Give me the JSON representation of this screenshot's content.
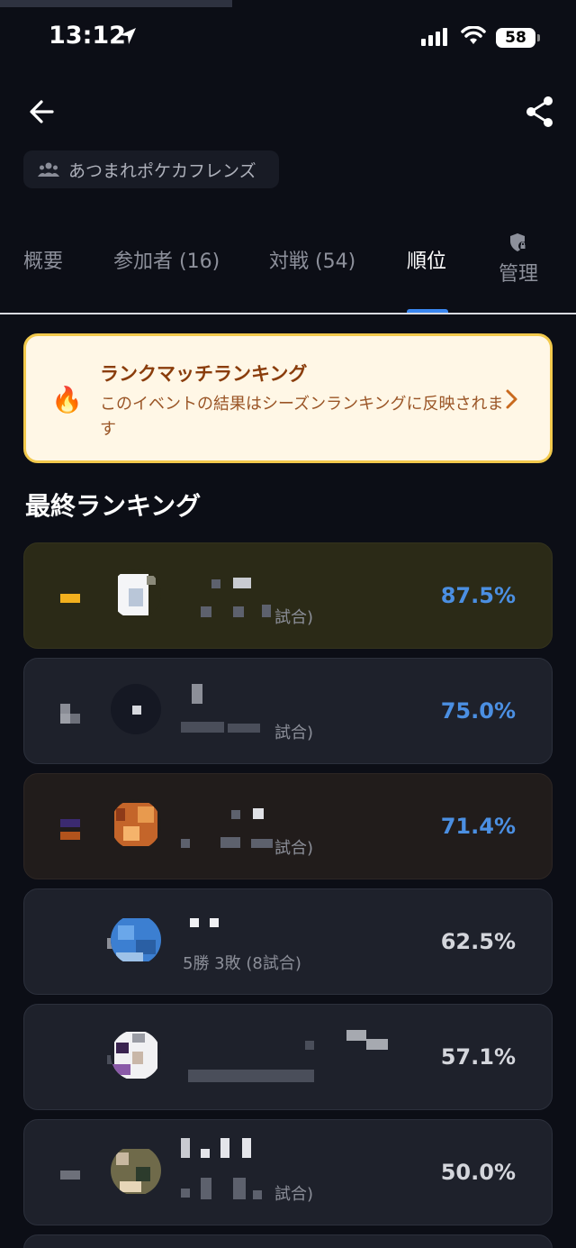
{
  "status_bar": {
    "time": "13:12",
    "battery": "58"
  },
  "header": {
    "group_name": "あつまれポケカフレンズ"
  },
  "tabs": [
    {
      "label": "概要"
    },
    {
      "label": "参加者 (16)"
    },
    {
      "label": "対戦 (54)"
    },
    {
      "label": "順位",
      "active": true
    },
    {
      "label": "管理"
    }
  ],
  "banner": {
    "title": "ランクマッチランキング",
    "description": "このイベントの結果はシーズンランキングに反映されます",
    "icon": "fire-icon"
  },
  "section_title": "最終ランキング",
  "rankings": [
    {
      "record": "試合)",
      "percent": "87.5%"
    },
    {
      "record": "試合)",
      "percent": "75.0%"
    },
    {
      "record": "試合)",
      "percent": "71.4%"
    },
    {
      "record": "5勝 3敗 (8試合)",
      "percent": "62.5%"
    },
    {
      "record": "",
      "percent": "57.1%"
    },
    {
      "record": "試合)",
      "percent": "50.0%"
    }
  ],
  "colors": {
    "accent": "#3a86f0",
    "percent_blue": "#4b8fe2",
    "banner_bg": "#fff7e6",
    "banner_border": "#f2c94c",
    "banner_title": "#8a3d0c"
  }
}
